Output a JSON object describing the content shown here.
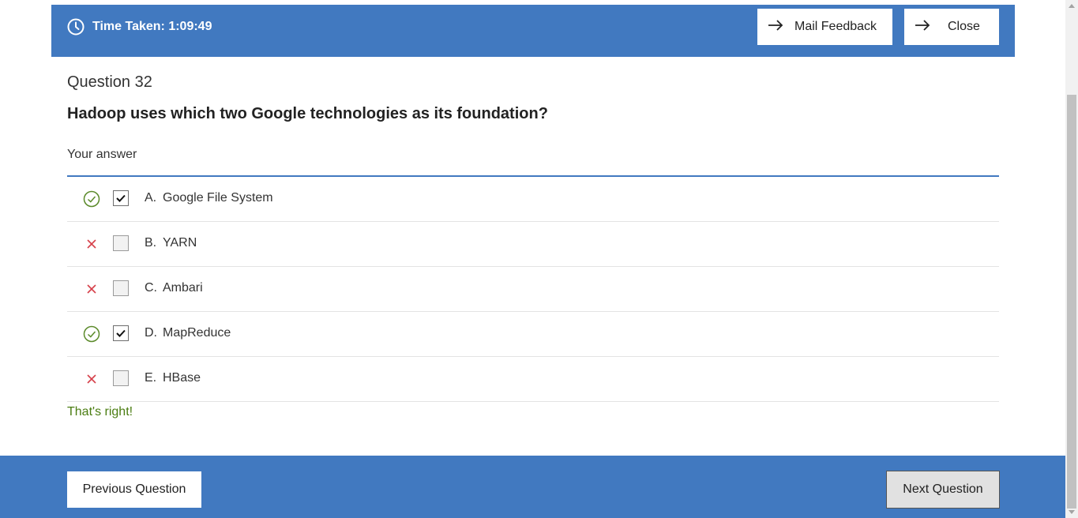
{
  "header": {
    "timer_label": "Time Taken: 1:09:49",
    "mail_feedback_label": "Mail Feedback",
    "close_label": "Close",
    "background_color": "#4179c0"
  },
  "question": {
    "number_label": "Question 32",
    "text": "Hadoop uses which two Google technologies as its foundation?",
    "answer_label": "Your answer"
  },
  "options": [
    {
      "letter": "A.",
      "text": "Google File System",
      "checked": true,
      "status": "correct"
    },
    {
      "letter": "B.",
      "text": "YARN",
      "checked": false,
      "status": "incorrect"
    },
    {
      "letter": "C.",
      "text": "Ambari",
      "checked": false,
      "status": "incorrect"
    },
    {
      "letter": "D.",
      "text": "MapReduce",
      "checked": true,
      "status": "correct"
    },
    {
      "letter": "E.",
      "text": "HBase",
      "checked": false,
      "status": "incorrect"
    }
  ],
  "feedback": {
    "text": "That's right!",
    "color": "#4b7d12"
  },
  "footer": {
    "previous_label": "Previous Question",
    "next_label": "Next Question"
  },
  "colors": {
    "correct_icon": "#5b8a2a",
    "incorrect_icon": "#d6404a",
    "accent": "#4179c0"
  }
}
